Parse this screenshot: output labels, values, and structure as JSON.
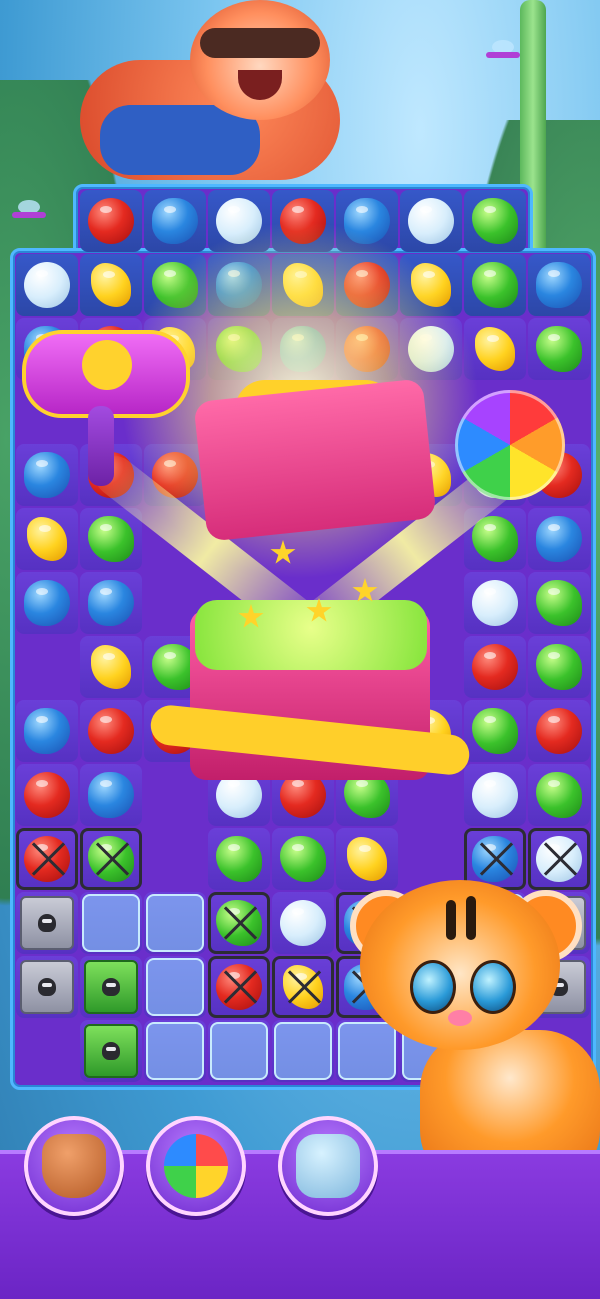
{
  "scene": {
    "title": ""
  },
  "colors": {
    "board_purple": "#6a2ecb",
    "board_border": "#4fb8ff",
    "bottom_bar": "#7a2fd3"
  },
  "characters": {
    "top": "raccoon-character",
    "bottom_right": "tiger-character"
  },
  "reward": {
    "items": [
      "hammer-booster",
      "gift-box",
      "rainbow-ball"
    ]
  },
  "boosters": [
    {
      "name": "glove-booster",
      "icon": "glove-icon"
    },
    {
      "name": "gem-booster",
      "icon": "gem-icon"
    },
    {
      "name": "hammer-booster",
      "icon": "hammer-icon"
    }
  ]
}
